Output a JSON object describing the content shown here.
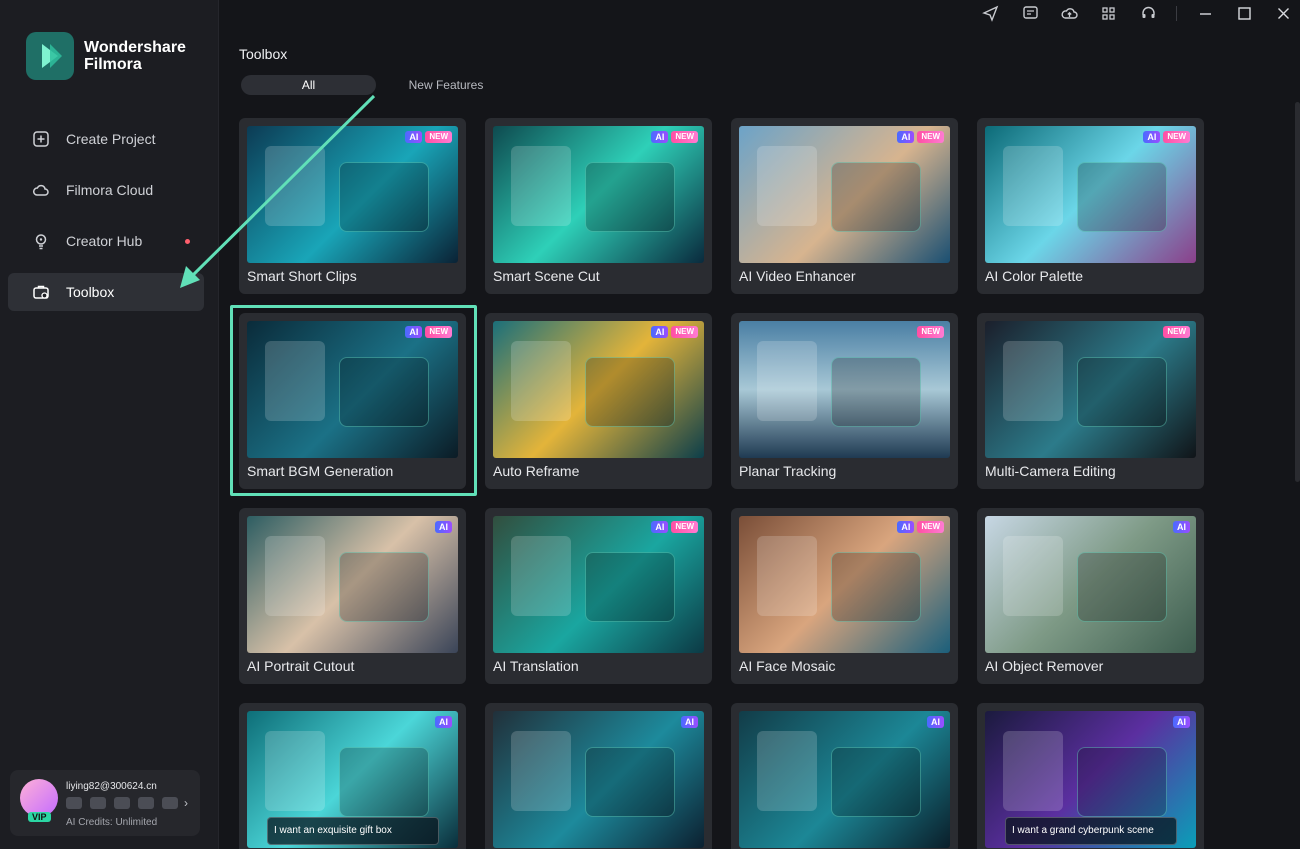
{
  "brand": {
    "name_line1": "Wondershare",
    "name_line2": "Filmora"
  },
  "sidebar": {
    "items": [
      {
        "label": "Create Project",
        "icon": "plus-square-icon"
      },
      {
        "label": "Filmora Cloud",
        "icon": "cloud-icon"
      },
      {
        "label": "Creator Hub",
        "icon": "bulb-icon",
        "has_notification_dot": true
      },
      {
        "label": "Toolbox",
        "icon": "toolbox-icon",
        "active": true
      }
    ]
  },
  "user": {
    "email": "liying82@300624.cn",
    "credits": "AI Credits: Unlimited",
    "badge": "VIP"
  },
  "titlebar": {
    "icons": [
      "send-icon",
      "feedback-icon",
      "cloud-upload-icon",
      "apps-grid-icon",
      "headset-icon",
      "minimize-icon",
      "maximize-icon",
      "close-icon"
    ]
  },
  "main": {
    "title": "Toolbox",
    "tabs": [
      {
        "label": "All",
        "active": true
      },
      {
        "label": "New Features",
        "active": false
      }
    ]
  },
  "tools": [
    {
      "label": "Smart Short Clips",
      "ai": true,
      "new": true
    },
    {
      "label": "Smart Scene Cut",
      "ai": true,
      "new": true
    },
    {
      "label": "AI Video Enhancer",
      "ai": true,
      "new": true
    },
    {
      "label": "AI Color Palette",
      "ai": true,
      "new": true
    },
    {
      "label": "Smart BGM Generation",
      "ai": true,
      "new": true,
      "highlighted": true
    },
    {
      "label": "Auto Reframe",
      "ai": true,
      "new": true
    },
    {
      "label": "Planar Tracking",
      "ai": false,
      "new": true
    },
    {
      "label": "Multi-Camera Editing",
      "ai": false,
      "new": true
    },
    {
      "label": "AI Portrait Cutout",
      "ai": true,
      "new": false
    },
    {
      "label": "AI Translation",
      "ai": true,
      "new": true
    },
    {
      "label": "AI Face Mosaic",
      "ai": true,
      "new": true
    },
    {
      "label": "AI Object Remover",
      "ai": true,
      "new": false
    },
    {
      "label": "",
      "ai": true,
      "new": false,
      "prompt": "I want an exquisite gift box"
    },
    {
      "label": "",
      "ai": true,
      "new": false
    },
    {
      "label": "",
      "ai": true,
      "new": false
    },
    {
      "label": "",
      "ai": true,
      "new": false,
      "prompt": "I want a grand cyberpunk scene"
    }
  ],
  "badge_text": {
    "ai": "AI",
    "new": "NEW"
  },
  "colors": {
    "accent": "#61e0b8",
    "sidebar_bg": "#1c1d22",
    "main_bg": "#141519",
    "card_bg": "#2a2c31"
  }
}
